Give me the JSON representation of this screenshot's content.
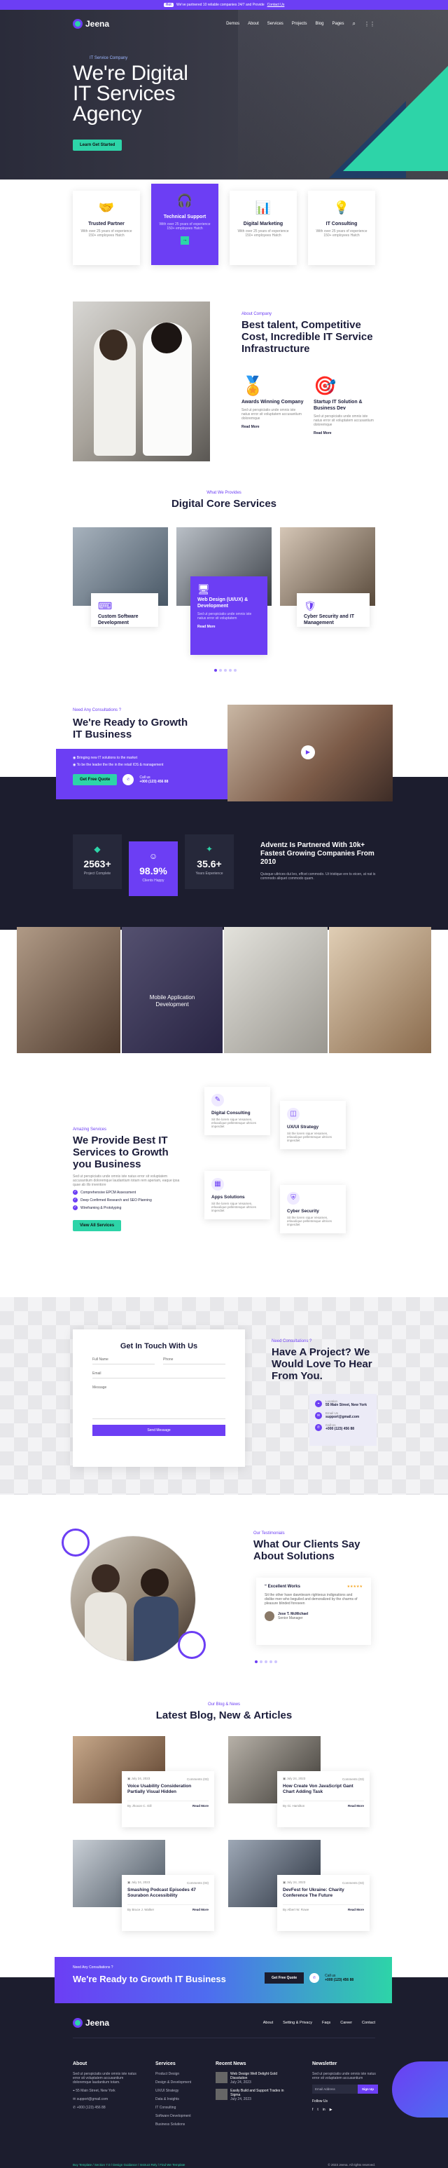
{
  "topbar": {
    "badge": "Hot",
    "text": "We've partnered 10 reliable companies 24/7 and Provide",
    "link": "Contact Us"
  },
  "nav": {
    "brand": "Jeena",
    "items": [
      "Demos",
      "About",
      "Services",
      "Projects",
      "Blog",
      "Pages"
    ]
  },
  "hero": {
    "sub": "IT Service Company",
    "line1": "We're Digital",
    "line2": "IT Services",
    "line3": "Agency",
    "button": "Learn Get Started"
  },
  "features": [
    {
      "title": "Trusted Partner",
      "text": "With over 25 years of experience 150+ employees Hatch"
    },
    {
      "title": "Technical Support",
      "text": "With over 25 years of experience 150+ employees Hatch"
    },
    {
      "title": "Digital Marketing",
      "text": "With over 25 years of experience 150+ employees Hatch"
    },
    {
      "title": "IT Consulting",
      "text": "With over 25 years of experience 150+ employees Hatch"
    }
  ],
  "about": {
    "tag": "About Company",
    "title": "Best talent, Competitive Cost, Incredible IT Service Infrastructure",
    "items": [
      {
        "title": "Awards Winning Company",
        "text": "Sed ut perspiciatis unde omnis iste natus error sit voluptatem accusantium doloremque",
        "link": "Read More"
      },
      {
        "title": "Startup IT Solution & Business Dev",
        "text": "Sed ut perspiciatis unde omnis iste natus error sit voluptatem accusantium doloremque",
        "link": "Read More"
      }
    ]
  },
  "services": {
    "tag": "What We Provides",
    "title": "Digital Core Services",
    "items": [
      {
        "title": "Custom Software Development"
      },
      {
        "title": "Web Design (UI/UX) & Development",
        "text": "Sed ut perspiciatis unde omnis iste natus error sit voluptatem",
        "link": "Read More"
      },
      {
        "title": "Cyber Security and IT Management"
      }
    ]
  },
  "ready": {
    "tag": "Need Any Consultations ?",
    "title": "We're Ready to Growth IT Business",
    "items": [
      "Bringing new IT solutions to the market",
      "To be the leader the the in the retail IOS & management"
    ],
    "button": "Get Free Quote",
    "call_label": "Call us",
    "phone": "+000 (123) 456 88"
  },
  "stats": [
    {
      "value": "2563+",
      "label": "Project Complete"
    },
    {
      "value": "98.9%",
      "label": "Clients Happy"
    },
    {
      "value": "35.6+",
      "label": "Years Experience"
    }
  ],
  "partner": {
    "title": "Adventz Is Partnered With 10k+ Fastest Growing Companies From 2010",
    "text": "Quisque ultrices dui leo, effcet commodo. Ut tristique ere ts eicen, at nat is commodo aliquet commodo quam."
  },
  "gallery": {
    "caption": "Mobile Application Development"
  },
  "amazing": {
    "tag": "Amazing Services",
    "title": "We Provide Best IT Services to Growth you Business",
    "text": "Sed ut perspiciatis unde omnis iste natus error sit voluptatem accusantium doloremque laudantium totam rem aperiam, eaque ipsa quae ab illo inventore",
    "list": [
      "Comprehensive EPCM Assessment",
      "Deep Confirmed Research and SEO Planning",
      "Wireframing & Prototyping"
    ],
    "button": "View All Services",
    "cards": [
      {
        "title": "Digital Consulting",
        "text": "Sit the lorem sique Vesamen, erlaxulique pellentesque ultrices imperdiet"
      },
      {
        "title": "UX/UI Strategy",
        "text": "Sit the lorem sique Vesamen, erlaxulique pellentesque ultrices imperdiet"
      },
      {
        "title": "Apps Solutions",
        "text": "Sit the lorem sique Vesamen, erlaxulique pellentesque ultrices imperdiet"
      },
      {
        "title": "Cyber Security",
        "text": "Sit the lorem sique Vesamen, erlaxulique pellentesque ultrices imperdiet"
      }
    ]
  },
  "contact": {
    "title": "Get In Touch With Us",
    "fields": [
      "Full Name",
      "Phone",
      "Email",
      "Message"
    ],
    "button": "Send Message",
    "tag": "Need Consultations ?",
    "heading": "Have A Project? We Would Love To Hear From You.",
    "info": [
      {
        "label": "Location",
        "value": "55 Main Street, New York"
      },
      {
        "label": "Email Us",
        "value": "support@gmail.com"
      },
      {
        "label": "Call Us",
        "value": "+000 (123) 456 88"
      }
    ]
  },
  "testimonial": {
    "tag": "Our Testimonials",
    "title": "What Our Clients Say About Solutions",
    "quote_title": "Excellent Works",
    "text": "Sit the other have dawnlessm righteous indignations and dislike men who beguiled and demoralized by the charms of pleasure blinded foreseen",
    "name": "Jose T. McMichael",
    "role": "Senior Manager"
  },
  "blog": {
    "tag": "Our Blog & News",
    "title": "Latest Blog, New & Articles",
    "posts": [
      {
        "date": "July 24, 2023",
        "comments": "Comments (03)",
        "title": "Voice Usability Consideration Partially Visual Hidden",
        "author": "By Jhoxon C. Gill",
        "link": "Read More"
      },
      {
        "date": "July 24, 2023",
        "comments": "Comments (03)",
        "title": "How Create Von JavaScript Gant Chart Adding Task",
        "author": "By Gi. Hamilton",
        "link": "Read More"
      },
      {
        "date": "July 24, 2023",
        "comments": "Comments (03)",
        "title": "Smashing Podcast Episodes 47 Sourabon Accessibility",
        "author": "By Bruce J. Walker",
        "link": "Read More"
      },
      {
        "date": "July 24, 2023",
        "comments": "Comments (03)",
        "title": "DevFest for Ukraine: Charity Conference The Future",
        "author": "By Albert W. Rowe",
        "link": "Read More"
      }
    ]
  },
  "cta": {
    "tag": "Need Any Consultations ?",
    "title": "We're Ready to Growth IT Business",
    "button": "Get Free Quote",
    "phone_label": "Call us",
    "phone": "+000 (123) 456 88"
  },
  "footer": {
    "brand": "Jeena",
    "links": [
      "About",
      "Setting & Privacy",
      "Faqs",
      "Career",
      "Contact"
    ],
    "about_title": "About",
    "about_text": "Sed ut perspiciatis unde omnis iste natus error sit voluptatem accusantium doloremque laudantium totam.",
    "address": "55 Main Street, New York",
    "email": "support@gmail.com",
    "phone": "+000 (123) 456 88",
    "services_title": "Services",
    "services": [
      "Product Design",
      "Design & Development",
      "UX/UI Strategy",
      "Data & Insights",
      "IT Consulting",
      "Software Development",
      "Business Solutions"
    ],
    "news_title": "Recent News",
    "news": [
      {
        "title": "Web Design Well Delight Gold Dissolution",
        "date": "July 24, 2023"
      },
      {
        "title": "Easily Build and Support Trades in Sigma",
        "date": "July 24, 2023"
      }
    ],
    "newsletter_title": "Newsletter",
    "newsletter_text": "Sed ut perspiciatis unde omnis iste natus error sit voluptatem accusantium",
    "email_placeholder": "Email Address",
    "sign_up": "Sign Up",
    "follow": "Follow Us",
    "bottom_left": "Buy Template / Section 7.0 / Design Guidance / Instruct Rely / Find We Template",
    "copyright": "© 2023 Jeena. All rights reserved."
  }
}
